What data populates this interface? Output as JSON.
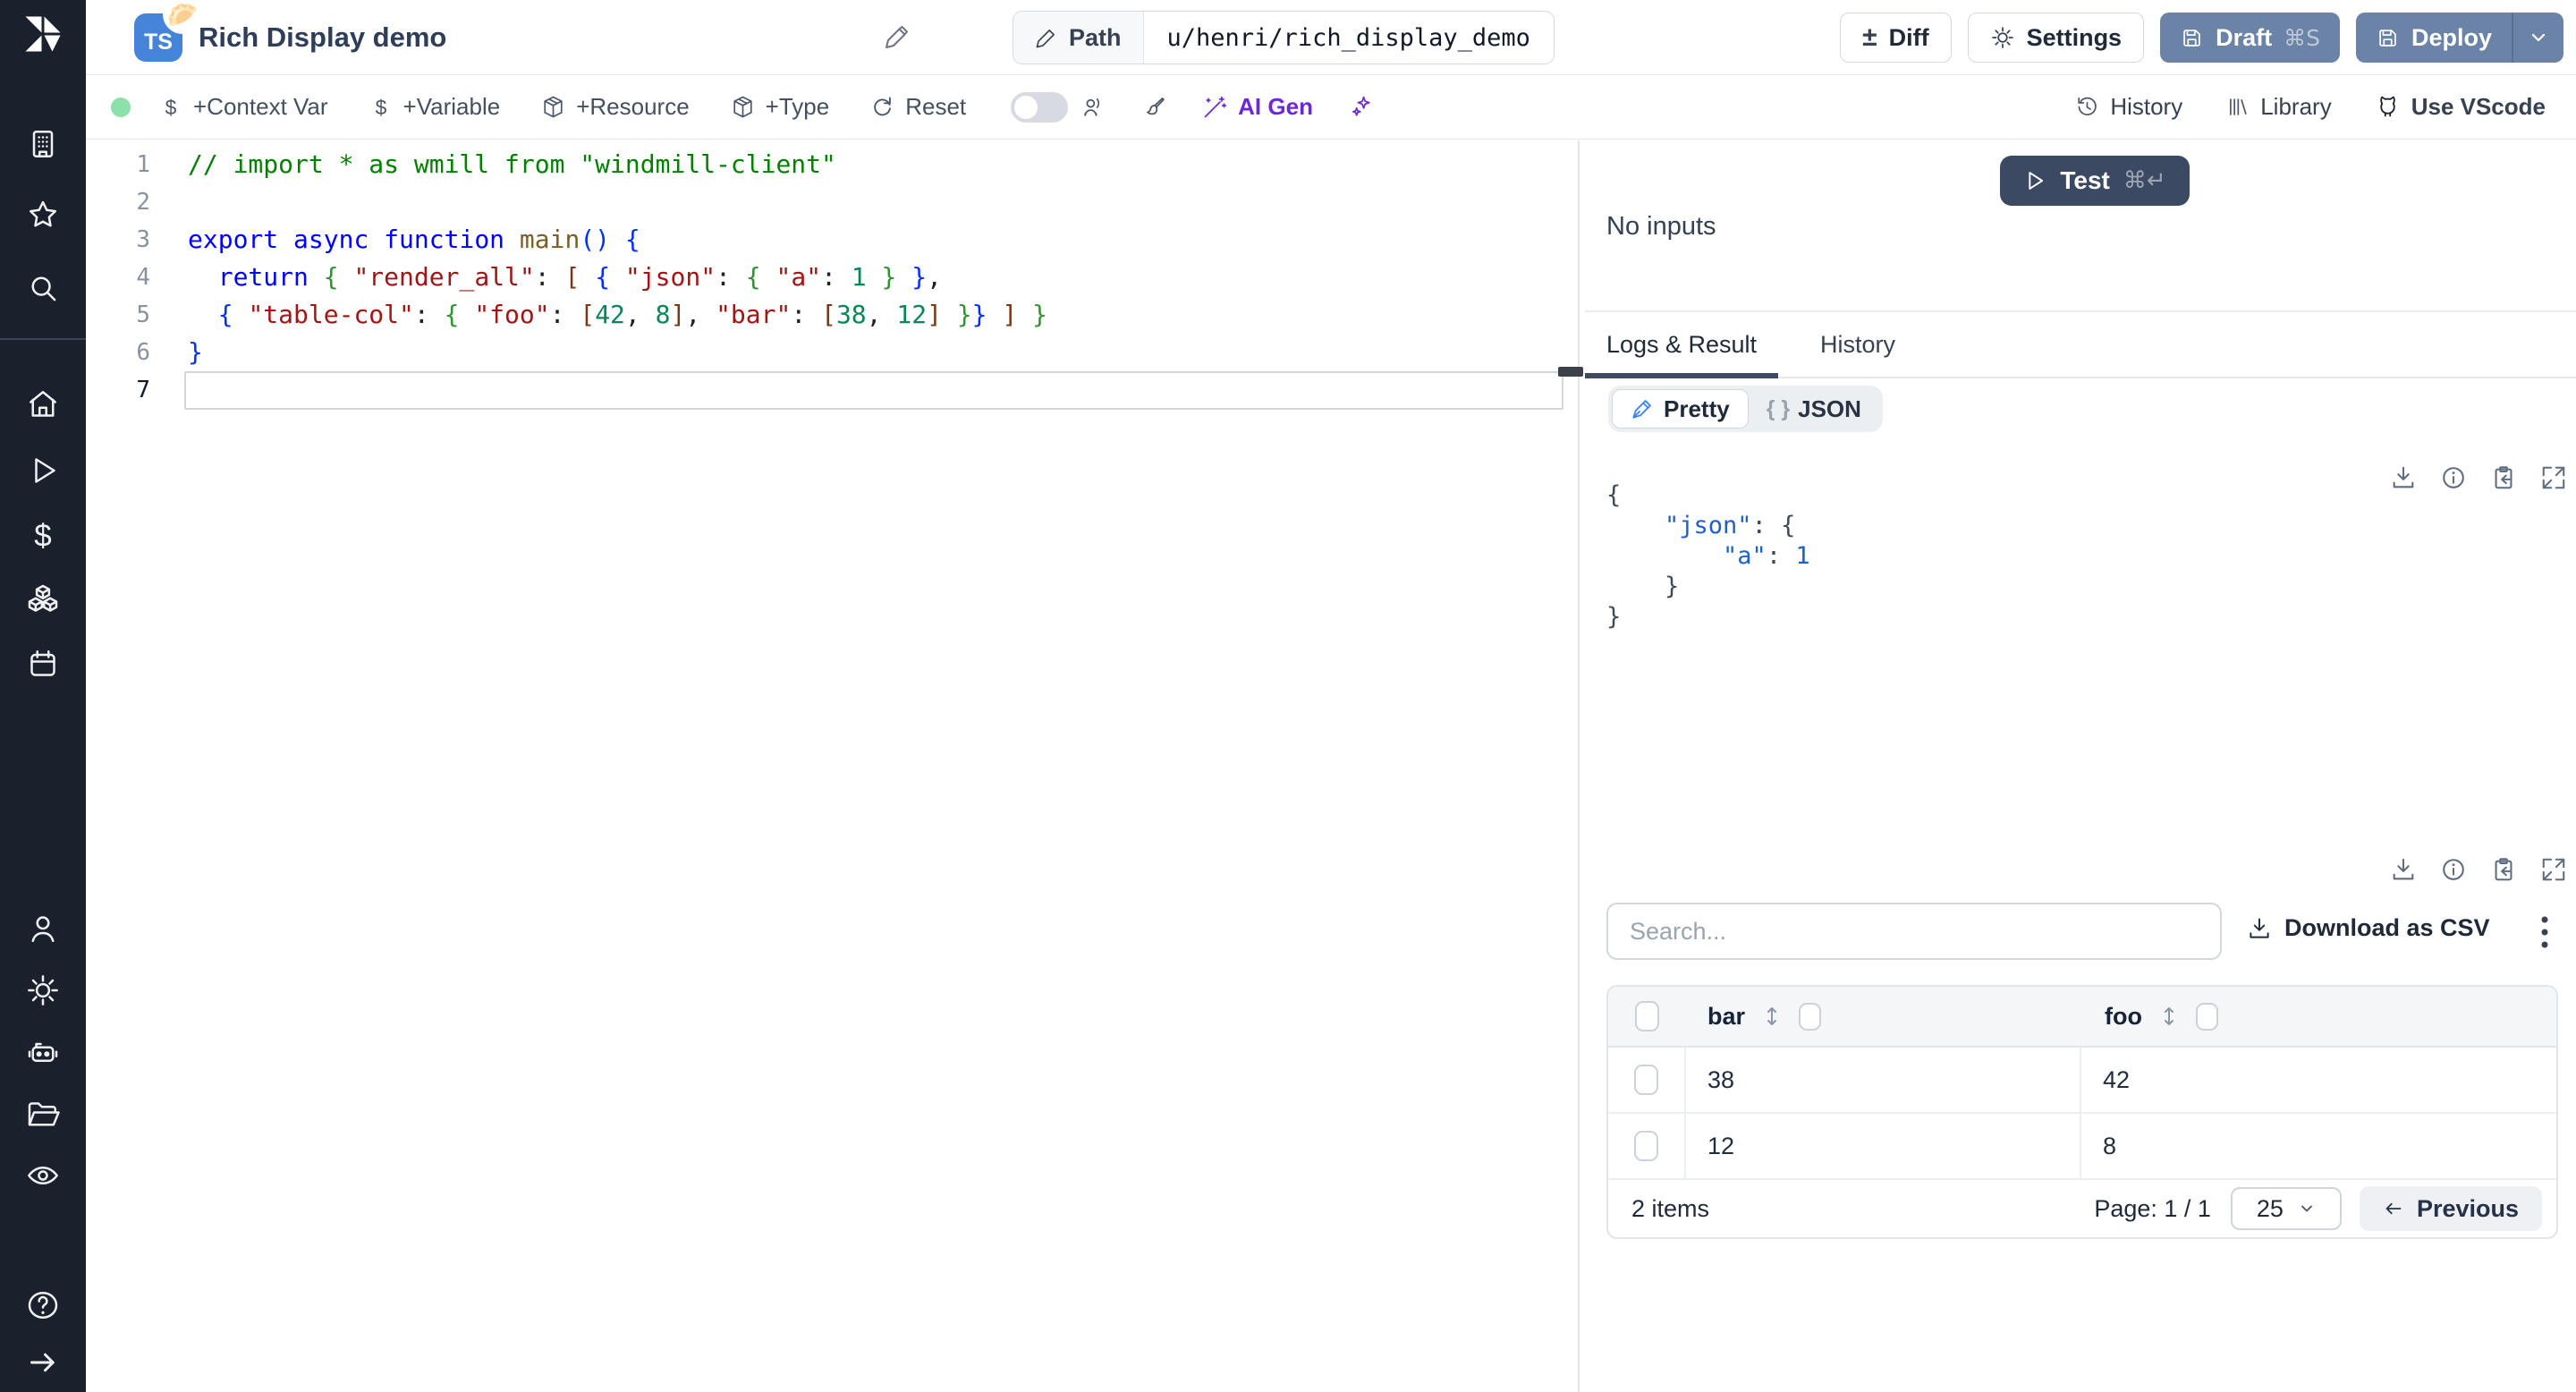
{
  "sidebar": {
    "icon_names": [
      "windmill-logo",
      "building",
      "star",
      "search",
      "home",
      "play-runs",
      "dollar",
      "cubes",
      "calendar",
      "user",
      "settings-gear",
      "robot-worker",
      "folder",
      "eye-audit",
      "help-question",
      "arrow-right-expand"
    ]
  },
  "header": {
    "language_badge": "TS",
    "emoji_badge": "🥟",
    "title": "Rich Display demo",
    "path_button": {
      "label": "Path",
      "value": "u/henri/rich_display_demo"
    },
    "diff_label": "Diff",
    "diff_icon": "±",
    "settings_label": "Settings",
    "draft_label": "Draft",
    "draft_shortcut": "⌘S",
    "deploy_label": "Deploy"
  },
  "toolbar": {
    "context_var": "+Context Var",
    "variable": "+Variable",
    "resource": "+Resource",
    "type": "+Type",
    "reset": "Reset",
    "ai_gen": "AI Gen",
    "history": "History",
    "library": "Library",
    "use_vscode": "Use VScode"
  },
  "editor": {
    "line_numbers": [
      "1",
      "2",
      "3",
      "4",
      "5",
      "6",
      "7"
    ],
    "active_line": 7,
    "lines": [
      [
        [
          "// import * as wmill from \"windmill-client\"",
          "cmt"
        ]
      ],
      [],
      [
        [
          "export",
          "kw"
        ],
        [
          " ",
          "p"
        ],
        [
          "async",
          "kw"
        ],
        [
          " ",
          "p"
        ],
        [
          "function",
          "kw"
        ],
        [
          " ",
          "p"
        ],
        [
          "main",
          "fn"
        ],
        [
          "()",
          "b1"
        ],
        [
          " ",
          "p"
        ],
        [
          "{",
          "b1"
        ]
      ],
      [
        [
          "  ",
          "p"
        ],
        [
          "return",
          "kw"
        ],
        [
          " ",
          "p"
        ],
        [
          "{",
          "b2"
        ],
        [
          " ",
          "p"
        ],
        [
          "\"render_all\"",
          "str"
        ],
        [
          ": ",
          "p"
        ],
        [
          "[",
          "b3"
        ],
        [
          " ",
          "p"
        ],
        [
          "{",
          "b1"
        ],
        [
          " ",
          "p"
        ],
        [
          "\"json\"",
          "str"
        ],
        [
          ": ",
          "p"
        ],
        [
          "{",
          "b2"
        ],
        [
          " ",
          "p"
        ],
        [
          "\"a\"",
          "str"
        ],
        [
          ": ",
          "p"
        ],
        [
          "1",
          "num"
        ],
        [
          " ",
          "p"
        ],
        [
          "}",
          "b2"
        ],
        [
          " ",
          "p"
        ],
        [
          "}",
          "b1"
        ],
        [
          ",",
          "p"
        ]
      ],
      [
        [
          "  ",
          "p"
        ],
        [
          "{",
          "b1"
        ],
        [
          " ",
          "p"
        ],
        [
          "\"table-col\"",
          "str"
        ],
        [
          ": ",
          "p"
        ],
        [
          "{",
          "b2"
        ],
        [
          " ",
          "p"
        ],
        [
          "\"foo\"",
          "str"
        ],
        [
          ": ",
          "p"
        ],
        [
          "[",
          "b3"
        ],
        [
          "42",
          "num"
        ],
        [
          ", ",
          "p"
        ],
        [
          "8",
          "num"
        ],
        [
          "]",
          "b3"
        ],
        [
          ", ",
          "p"
        ],
        [
          "\"bar\"",
          "str"
        ],
        [
          ": ",
          "p"
        ],
        [
          "[",
          "b3"
        ],
        [
          "38",
          "num"
        ],
        [
          ", ",
          "p"
        ],
        [
          "12",
          "num"
        ],
        [
          "]",
          "b3"
        ],
        [
          " ",
          "p"
        ],
        [
          "}",
          "b2"
        ],
        [
          "}",
          "b1"
        ],
        [
          " ",
          "p"
        ],
        [
          "]",
          "b3"
        ],
        [
          " ",
          "p"
        ],
        [
          "}",
          "b2"
        ]
      ],
      [
        [
          "}",
          "b1"
        ]
      ],
      []
    ]
  },
  "run_panel": {
    "test_label": "Test",
    "test_shortcut": "⌘↵",
    "no_inputs": "No inputs"
  },
  "result_panel": {
    "tabs": {
      "logs": "Logs & Result",
      "history": "History"
    },
    "active_tab": "Logs & Result",
    "view_modes": {
      "pretty": "Pretty",
      "json_icon": "{ }",
      "json": "JSON"
    },
    "toolbar_icon_names": [
      "download",
      "info",
      "copy-to-clipboard",
      "expand"
    ],
    "result_json": [
      [
        [
          "{",
          "jp"
        ]
      ],
      [
        [
          "    ",
          "jp"
        ],
        [
          "\"json\"",
          "key"
        ],
        [
          ": ",
          "jp"
        ],
        [
          "{",
          "jp"
        ]
      ],
      [
        [
          "        ",
          "jp"
        ],
        [
          "\"a\"",
          "key"
        ],
        [
          ": ",
          "jp"
        ],
        [
          "1",
          "val"
        ]
      ],
      [
        [
          "    }",
          "jp"
        ]
      ],
      [
        [
          "}",
          "jp"
        ]
      ]
    ]
  },
  "table_panel": {
    "search_placeholder": "Search...",
    "download_csv": "Download as CSV",
    "columns": [
      "bar",
      "foo"
    ],
    "rows": [
      [
        "38",
        "42"
      ],
      [
        "12",
        "8"
      ]
    ],
    "footer": {
      "items": "2 items",
      "page": "Page: 1 / 1",
      "page_size": "25",
      "previous": "Previous"
    }
  },
  "colors": {
    "sidebar_bg": "#1b212c",
    "ts_badge_blue": "#4584d8",
    "slate_button": "#6b83a6",
    "dark_test_button": "#3b4963",
    "ai_purple": "#6d28d9",
    "green_status_dot": "#8ce0a9",
    "active_tab_underline": "#3d4a5f"
  }
}
